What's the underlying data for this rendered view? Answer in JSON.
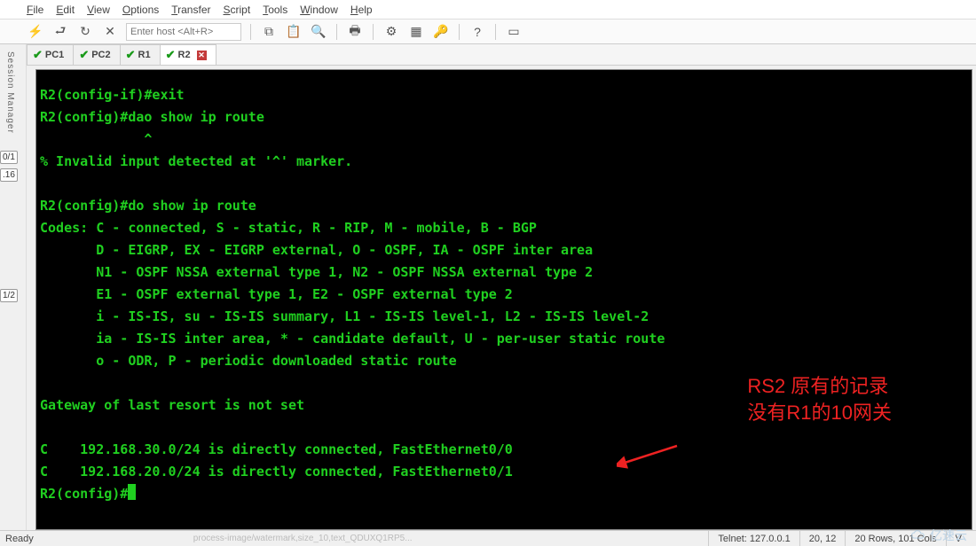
{
  "menu": {
    "items": [
      "File",
      "Edit",
      "View",
      "Options",
      "Transfer",
      "Script",
      "Tools",
      "Window",
      "Help"
    ]
  },
  "toolbar": {
    "enter_host_placeholder": "Enter host <Alt+R>"
  },
  "tabs": [
    {
      "label": "PC1",
      "active": false
    },
    {
      "label": "PC2",
      "active": false
    },
    {
      "label": "R1",
      "active": false
    },
    {
      "label": "R2",
      "active": true
    }
  ],
  "session_manager_label": "Session Manager",
  "side_tabs": {
    "t0_1": "0/1",
    "v16": ".16",
    "l1_2": "1/2"
  },
  "terminal_lines": [
    "R2(config-if)#exit",
    "R2(config)#dao show ip route",
    "             ^",
    "% Invalid input detected at '^' marker.",
    "",
    "R2(config)#do show ip route",
    "Codes: C - connected, S - static, R - RIP, M - mobile, B - BGP",
    "       D - EIGRP, EX - EIGRP external, O - OSPF, IA - OSPF inter area",
    "       N1 - OSPF NSSA external type 1, N2 - OSPF NSSA external type 2",
    "       E1 - OSPF external type 1, E2 - OSPF external type 2",
    "       i - IS-IS, su - IS-IS summary, L1 - IS-IS level-1, L2 - IS-IS level-2",
    "       ia - IS-IS inter area, * - candidate default, U - per-user static route",
    "       o - ODR, P - periodic downloaded static route",
    "",
    "Gateway of last resort is not set",
    "",
    "C    192.168.30.0/24 is directly connected, FastEthernet0/0",
    "C    192.168.20.0/24 is directly connected, FastEthernet0/1",
    "R2(config)#"
  ],
  "annotation": {
    "line1": "RS2 原有的记录",
    "line2": "没有R1的10网关"
  },
  "status": {
    "ready": "Ready",
    "ghost": "process-image/watermark,size_10,text_QDUXQ1RP5...",
    "telnet": "Telnet: 127.0.0.1",
    "cursor": "20,  12",
    "dims": "20 Rows, 101 Cols",
    "vt": "V"
  },
  "watermark": "亿速云"
}
